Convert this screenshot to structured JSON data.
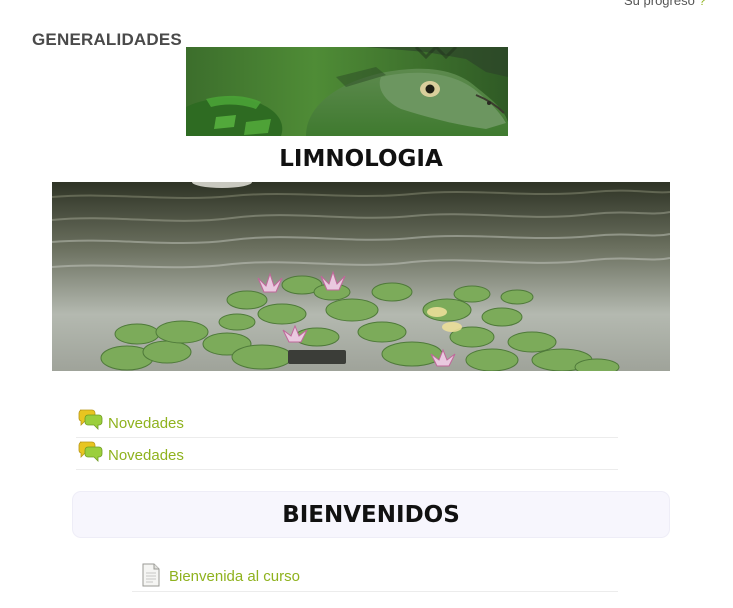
{
  "header": {
    "progress_label": "Su progreso",
    "progress_icon": "?"
  },
  "section": {
    "title": "GENERALIDADES"
  },
  "banner": {
    "course_title": "LIMNOLOGIA"
  },
  "activities": [
    {
      "label": "Novedades",
      "icon": "forum-icon"
    },
    {
      "label": "Novedades",
      "icon": "forum-icon"
    }
  ],
  "welcome": {
    "heading": "BIENVENIDOS",
    "resource_label": "Bienvenida al curso",
    "resource_icon": "document-icon"
  },
  "colors": {
    "link": "#8fb21e",
    "welcome_bg": "#f7f6fd",
    "heading": "#111111"
  }
}
